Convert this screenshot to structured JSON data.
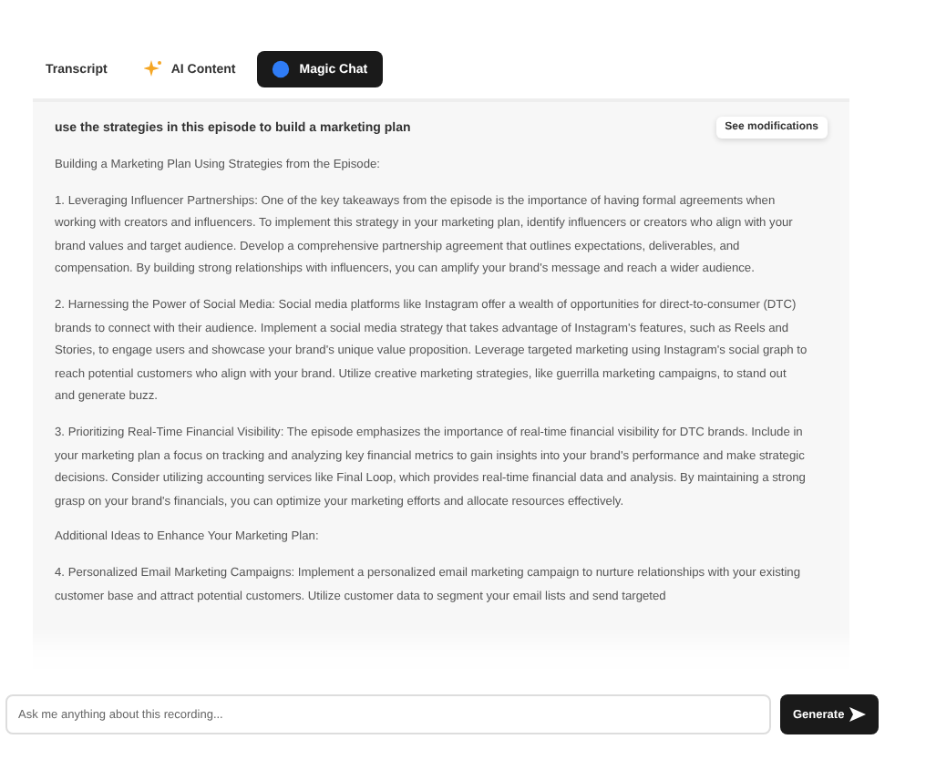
{
  "tabs": [
    {
      "label": "Transcript",
      "selected": false
    },
    {
      "label": "AI Content",
      "selected": false
    },
    {
      "label": "Magic Chat",
      "selected": true
    }
  ],
  "chat": {
    "prompt": "use the strategies in this episode to build a marketing plan",
    "action": "See modifications",
    "paragraphs": [
      "Building a Marketing Plan Using Strategies from the Episode:",
      "1. Leveraging Influencer Partnerships: One of the key takeaways from the episode is the importance of having formal agreements when working with creators and influencers. To implement this strategy in your marketing plan, identify influencers or creators who align with your brand values and target audience. Develop a comprehensive partnership agreement that outlines expectations, deliverables, and compensation. By building strong relationships with influencers, you can amplify your brand's message and reach a wider audience.",
      "2. Harnessing the Power of Social Media: Social media platforms like Instagram offer a wealth of opportunities for direct-to-consumer (DTC) brands to connect with their audience. Implement a social media strategy that takes advantage of Instagram's features, such as Reels and Stories, to engage users and showcase your brand's unique value proposition. Leverage targeted marketing using Instagram's social graph to reach potential customers who align with your brand. Utilize creative marketing strategies, like guerrilla marketing campaigns, to stand out and generate buzz.",
      "3. Prioritizing Real-Time Financial Visibility: The episode emphasizes the importance of real-time financial visibility for DTC brands. Include in your marketing plan a focus on tracking and analyzing key financial metrics to gain insights into your brand's performance and make strategic decisions. Consider utilizing accounting services like Final Loop, which provides real-time financial data and analysis. By maintaining a strong grasp on your brand's financials, you can optimize your marketing efforts and allocate resources effectively.",
      "Additional Ideas to Enhance Your Marketing Plan:",
      "4. Personalized Email Marketing Campaigns: Implement a personalized email marketing campaign to nurture relationships with your existing customer base and attract potential customers. Utilize customer data to segment your email lists and send targeted"
    ]
  },
  "composer": {
    "placeholder": "Ask me anything about this recording...",
    "button": "Generate"
  }
}
